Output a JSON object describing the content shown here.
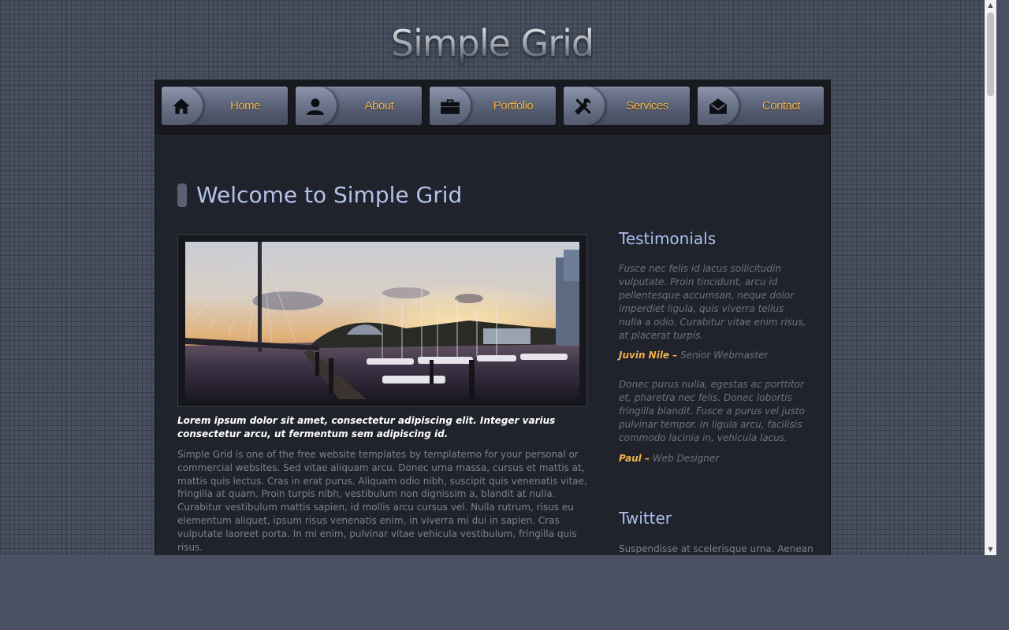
{
  "site": {
    "title": "Simple Grid"
  },
  "menu": {
    "items": [
      {
        "label": "Home",
        "icon": "home-icon"
      },
      {
        "label": "About",
        "icon": "user-icon"
      },
      {
        "label": "Portfolio",
        "icon": "briefcase-icon"
      },
      {
        "label": "Services",
        "icon": "tools-icon"
      },
      {
        "label": "Contact",
        "icon": "envelope-icon"
      }
    ]
  },
  "main": {
    "title": "Welcome to Simple Grid",
    "caption": "Lorem ipsum dolor sit amet, consectetur adipiscing elit. Integer varius consectetur arcu, ut fermentum sem adipiscing id.",
    "intro": "Simple Grid is one of the free website templates by templatemo for your personal or commercial websites. Sed vitae aliquam arcu. Donec urna massa, cursus et mattis at, mattis quis lectus. Cras in erat purus. Aliquam odio nibh, suscipit quis venenatis vitae, fringilla at quam. Proin turpis nibh, vestibulum non dignissim a, blandit at nulla. Curabitur vestibulum mattis sapien, id mollis arcu cursus vel. Nulla rutrum, risus eu elementum aliquet, ipsum risus venenatis enim, in viverra mi dui in sapien. Cras vulputate laoreet porta. In mi enim, pulvinar vitae vehicula vestibulum, fringilla quis risus."
  },
  "sidebar": {
    "testimonials_heading": "Testimonials",
    "testimonials": [
      {
        "quote": "Fusce nec felis id lacus sollicitudin vulputate. Proin tincidunt, arcu id pellentesque accumsan, neque dolor imperdiet ligula, quis viverra tellus nulla a odio. Curabitur vitae enim risus, at placerat turpis.",
        "name": "Juvin Nile –",
        "role": "Senior Webmaster"
      },
      {
        "quote": "Donec purus nulla, egestas ac porttitor et, pharetra nec felis. Donec lobortis fringilla blandit. Fusce a purus vel justo pulvinar tempor. In ligula arcu, facilisis commodo lacinia in, vehicula lacus.",
        "name": "Paul –",
        "role": "Web Designer"
      }
    ],
    "twitter_heading": "Twitter",
    "twitter_text": "Suspendisse at scelerisque urna. Aenean"
  },
  "colors": {
    "accent": "#f2b24a",
    "heading": "#b2c2e8",
    "panel": "#21232c"
  }
}
